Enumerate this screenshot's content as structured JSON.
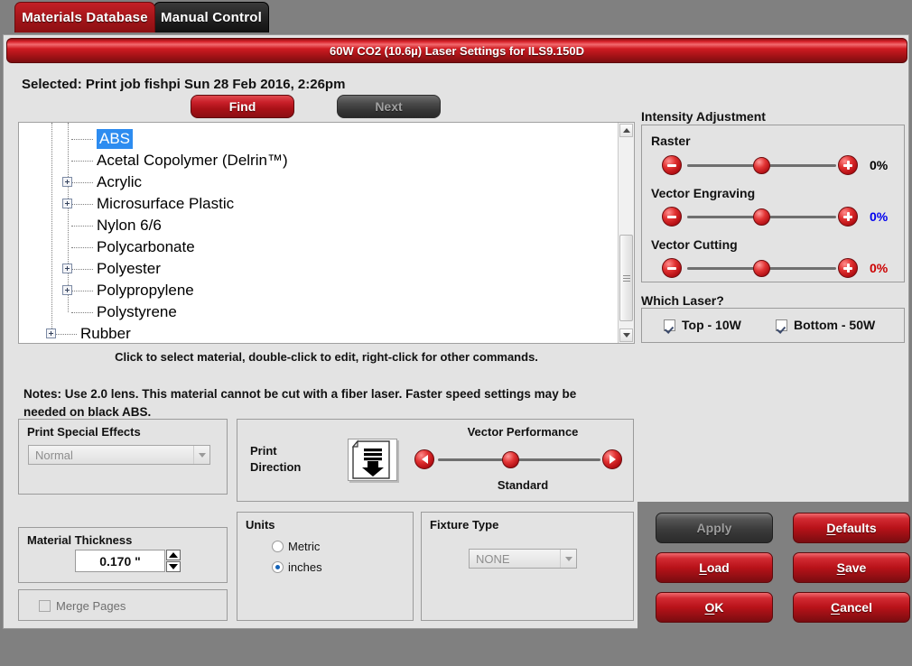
{
  "tabs": [
    {
      "label": "Materials Database",
      "active": true
    },
    {
      "label": "Manual Control",
      "active": false
    }
  ],
  "dialog": {
    "title": "60W CO2 (10.6µ) Laser Settings for ILS9.150D",
    "selected_line": "Selected: Print job fishpi Sun 28 Feb 2016,  2:26pm",
    "find_label": "Find",
    "next_label": "Next",
    "hint": "Click to select material, double-click to edit, right-click for other commands.",
    "notes": "Notes: Use 2.0 lens. This material cannot be cut with a fiber laser. Faster speed settings may be needed on black ABS."
  },
  "tree": {
    "items": [
      {
        "label": "ABS",
        "level": 2,
        "expandable": false,
        "selected": true
      },
      {
        "label": "Acetal Copolymer (Delrin™)",
        "level": 2,
        "expandable": false,
        "selected": false
      },
      {
        "label": "Acrylic",
        "level": 2,
        "expandable": true,
        "selected": false
      },
      {
        "label": "Microsurface Plastic",
        "level": 2,
        "expandable": true,
        "selected": false
      },
      {
        "label": "Nylon 6/6",
        "level": 2,
        "expandable": false,
        "selected": false
      },
      {
        "label": "Polycarbonate",
        "level": 2,
        "expandable": false,
        "selected": false
      },
      {
        "label": "Polyester",
        "level": 2,
        "expandable": true,
        "selected": false
      },
      {
        "label": "Polypropylene",
        "level": 2,
        "expandable": true,
        "selected": false
      },
      {
        "label": "Polystyrene",
        "level": 2,
        "expandable": false,
        "selected": false
      },
      {
        "label": "Rubber",
        "level": 1,
        "expandable": true,
        "selected": false
      }
    ]
  },
  "intensity": {
    "title": "Intensity Adjustment",
    "rows": [
      {
        "label": "Raster",
        "value": "0%",
        "color": "#000000"
      },
      {
        "label": "Vector Engraving",
        "value": "0%",
        "color": "#0000ee"
      },
      {
        "label": "Vector Cutting",
        "value": "0%",
        "color": "#cc0000"
      }
    ]
  },
  "which_laser": {
    "title": "Which Laser?",
    "options": [
      {
        "label": "Top - 10W",
        "checked": true
      },
      {
        "label": "Bottom - 50W",
        "checked": true
      }
    ]
  },
  "print_effects": {
    "title": "Print Special Effects",
    "value": "Normal"
  },
  "vector_panel": {
    "print_direction_label": "Print\nDirection",
    "vector_performance_title": "Vector Performance",
    "vector_performance_value": "Standard"
  },
  "material_thickness": {
    "title": "Material Thickness",
    "value": "0.170 \""
  },
  "merge_pages": {
    "label": "Merge Pages",
    "checked": false
  },
  "units": {
    "title": "Units",
    "options": [
      {
        "label": "Metric",
        "selected": false
      },
      {
        "label": "inches",
        "selected": true
      }
    ]
  },
  "fixture": {
    "title": "Fixture Type",
    "value": "NONE"
  },
  "buttons": {
    "apply": "Apply",
    "defaults": "Defaults",
    "load": "Load",
    "save": "Save",
    "ok": "OK",
    "cancel": "Cancel"
  }
}
